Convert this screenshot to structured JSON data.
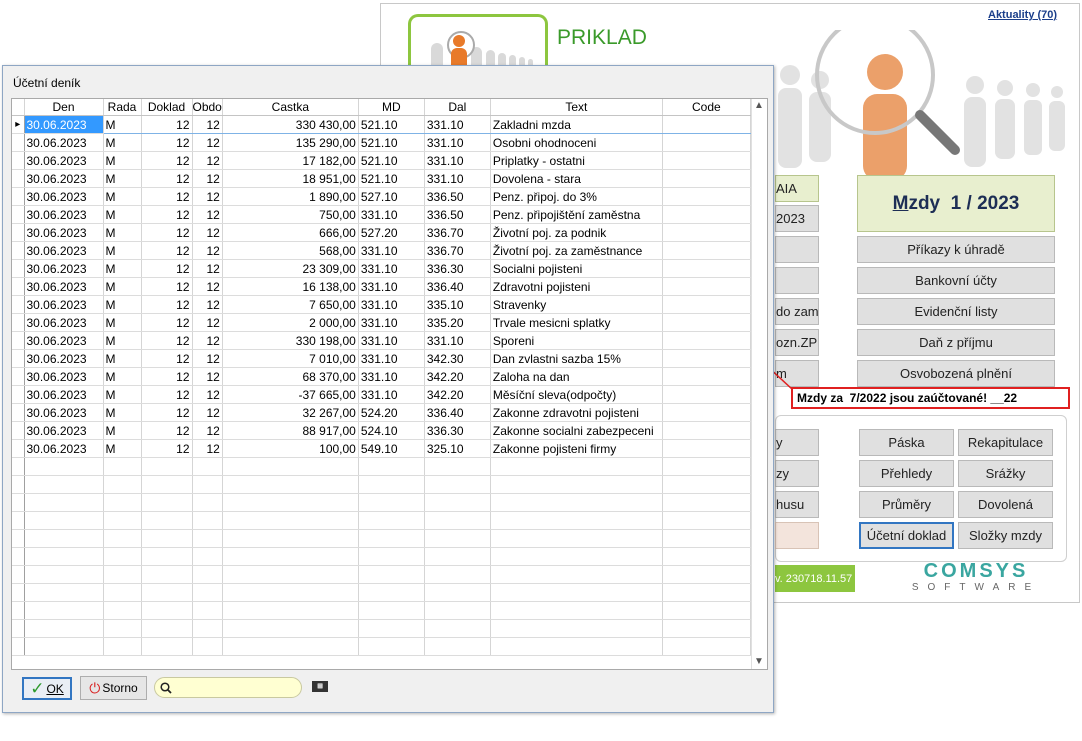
{
  "background_app": {
    "app_name": "PRIKLAD",
    "news_link": "Aktuality (70)",
    "title_prefix": "M",
    "title_rest": "zdy  1 / 2023",
    "left_tiles": [
      "AIA",
      "2023",
      "",
      "",
      "do zam",
      "ozn.ZP",
      "m"
    ],
    "right_buttons": [
      "Příkazy k úhradě",
      "Bankovní účty",
      "Evidenční listy",
      "Daň z příjmu",
      "Osvobozená plnění"
    ],
    "bottom_left_tiles": [
      "y",
      "zy",
      "husu",
      ""
    ],
    "bottom_buttons": [
      "Páska",
      "Rekapitulace",
      "Přehledy",
      "Srážky",
      "Průměry",
      "Dovolená",
      "Účetní doklad",
      "Složky mzdy"
    ],
    "version": "v. 230718.11.57",
    "brand_main": "COMSYS",
    "brand_sub": "SOFTWARE",
    "callout": "Mzdy za  7/2022 jsou zaúčtované! __22"
  },
  "dialog": {
    "title": "Účetní deník",
    "columns": [
      "Den",
      "Rada",
      "Doklad",
      "Obdo",
      "Castka",
      "MD",
      "Dal",
      "Text",
      "Code"
    ],
    "rows": [
      [
        "30.06.2023",
        "M",
        "12",
        "12",
        "330 430,00",
        "521.10",
        "331.10",
        "Zakladni mzda",
        ""
      ],
      [
        "30.06.2023",
        "M",
        "12",
        "12",
        "135 290,00",
        "521.10",
        "331.10",
        "Osobni ohodnoceni",
        ""
      ],
      [
        "30.06.2023",
        "M",
        "12",
        "12",
        "17 182,00",
        "521.10",
        "331.10",
        "Priplatky - ostatni",
        ""
      ],
      [
        "30.06.2023",
        "M",
        "12",
        "12",
        "18 951,00",
        "521.10",
        "331.10",
        "Dovolena - stara",
        ""
      ],
      [
        "30.06.2023",
        "M",
        "12",
        "12",
        "1 890,00",
        "527.10",
        "336.50",
        "Penz. připoj. do 3%",
        ""
      ],
      [
        "30.06.2023",
        "M",
        "12",
        "12",
        "750,00",
        "331.10",
        "336.50",
        "Penz. připojištění zaměstna",
        ""
      ],
      [
        "30.06.2023",
        "M",
        "12",
        "12",
        "666,00",
        "527.20",
        "336.70",
        "Životní poj. za podnik",
        ""
      ],
      [
        "30.06.2023",
        "M",
        "12",
        "12",
        "568,00",
        "331.10",
        "336.70",
        "Životní poj. za zaměstnance",
        ""
      ],
      [
        "30.06.2023",
        "M",
        "12",
        "12",
        "23 309,00",
        "331.10",
        "336.30",
        "Socialni pojisteni",
        ""
      ],
      [
        "30.06.2023",
        "M",
        "12",
        "12",
        "16 138,00",
        "331.10",
        "336.40",
        "Zdravotni pojisteni",
        ""
      ],
      [
        "30.06.2023",
        "M",
        "12",
        "12",
        "7 650,00",
        "331.10",
        "335.10",
        "Stravenky",
        ""
      ],
      [
        "30.06.2023",
        "M",
        "12",
        "12",
        "2 000,00",
        "331.10",
        "335.20",
        "Trvale mesicni splatky",
        ""
      ],
      [
        "30.06.2023",
        "M",
        "12",
        "12",
        "330 198,00",
        "331.10",
        "331.10",
        "Sporeni",
        ""
      ],
      [
        "30.06.2023",
        "M",
        "12",
        "12",
        "7 010,00",
        "331.10",
        "342.30",
        "Dan zvlastni sazba 15%",
        ""
      ],
      [
        "30.06.2023",
        "M",
        "12",
        "12",
        "68 370,00",
        "331.10",
        "342.20",
        "Zaloha na dan",
        ""
      ],
      [
        "30.06.2023",
        "M",
        "12",
        "12",
        "-37 665,00",
        "331.10",
        "342.20",
        "Měsíční sleva(odpočty)",
        ""
      ],
      [
        "30.06.2023",
        "M",
        "12",
        "12",
        "32 267,00",
        "524.20",
        "336.40",
        "Zakonne zdravotni pojisteni",
        ""
      ],
      [
        "30.06.2023",
        "M",
        "12",
        "12",
        "88 917,00",
        "524.10",
        "336.30",
        "Zakonne socialni zabezpeceni",
        ""
      ],
      [
        "30.06.2023",
        "M",
        "12",
        "12",
        "100,00",
        "549.10",
        "325.10",
        "Zakonne pojisteni firmy",
        ""
      ]
    ],
    "ok_label": "OK",
    "storno_label": "Storno",
    "search_value": "",
    "colors": {
      "selection": "#3399ff",
      "accent_green": "#8dc63f",
      "callout_red": "#e02020"
    }
  }
}
